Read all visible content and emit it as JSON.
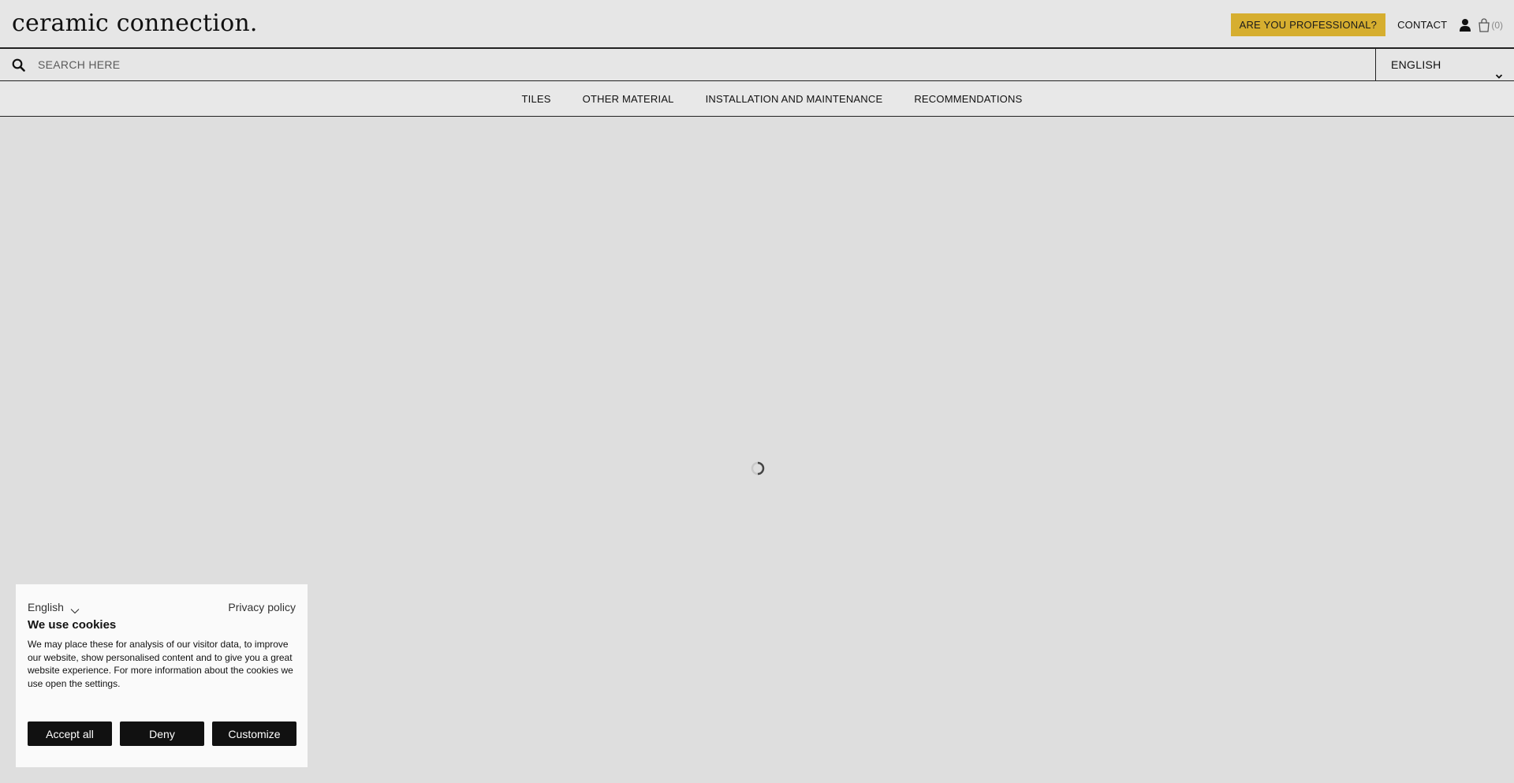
{
  "header": {
    "logo": "ceramic connection.",
    "professional_label": "ARE YOU PROFESSIONAL?",
    "contact_label": "CONTACT",
    "cart_count": "(0)",
    "accent_color": "#d6ae2f"
  },
  "search": {
    "placeholder": "SEARCH HERE",
    "language": "ENGLISH"
  },
  "nav": {
    "items": [
      {
        "label": "TILES"
      },
      {
        "label": "OTHER MATERIAL"
      },
      {
        "label": "INSTALLATION AND MAINTENANCE"
      },
      {
        "label": "RECOMMENDATIONS"
      }
    ]
  },
  "cookie": {
    "language": "English",
    "privacy_label": "Privacy policy",
    "title": "We use cookies",
    "text": "We may place these for analysis of our visitor data, to improve our website, show personalised content and to give you a great website experience. For more information about the cookies we use open the settings.",
    "accept_label": "Accept all",
    "deny_label": "Deny",
    "customize_label": "Customize"
  },
  "icons": {
    "search": "search-icon",
    "user": "user-icon",
    "cart": "cart-icon",
    "chevron": "chevron-down-icon",
    "spinner": "loading-spinner-icon"
  }
}
